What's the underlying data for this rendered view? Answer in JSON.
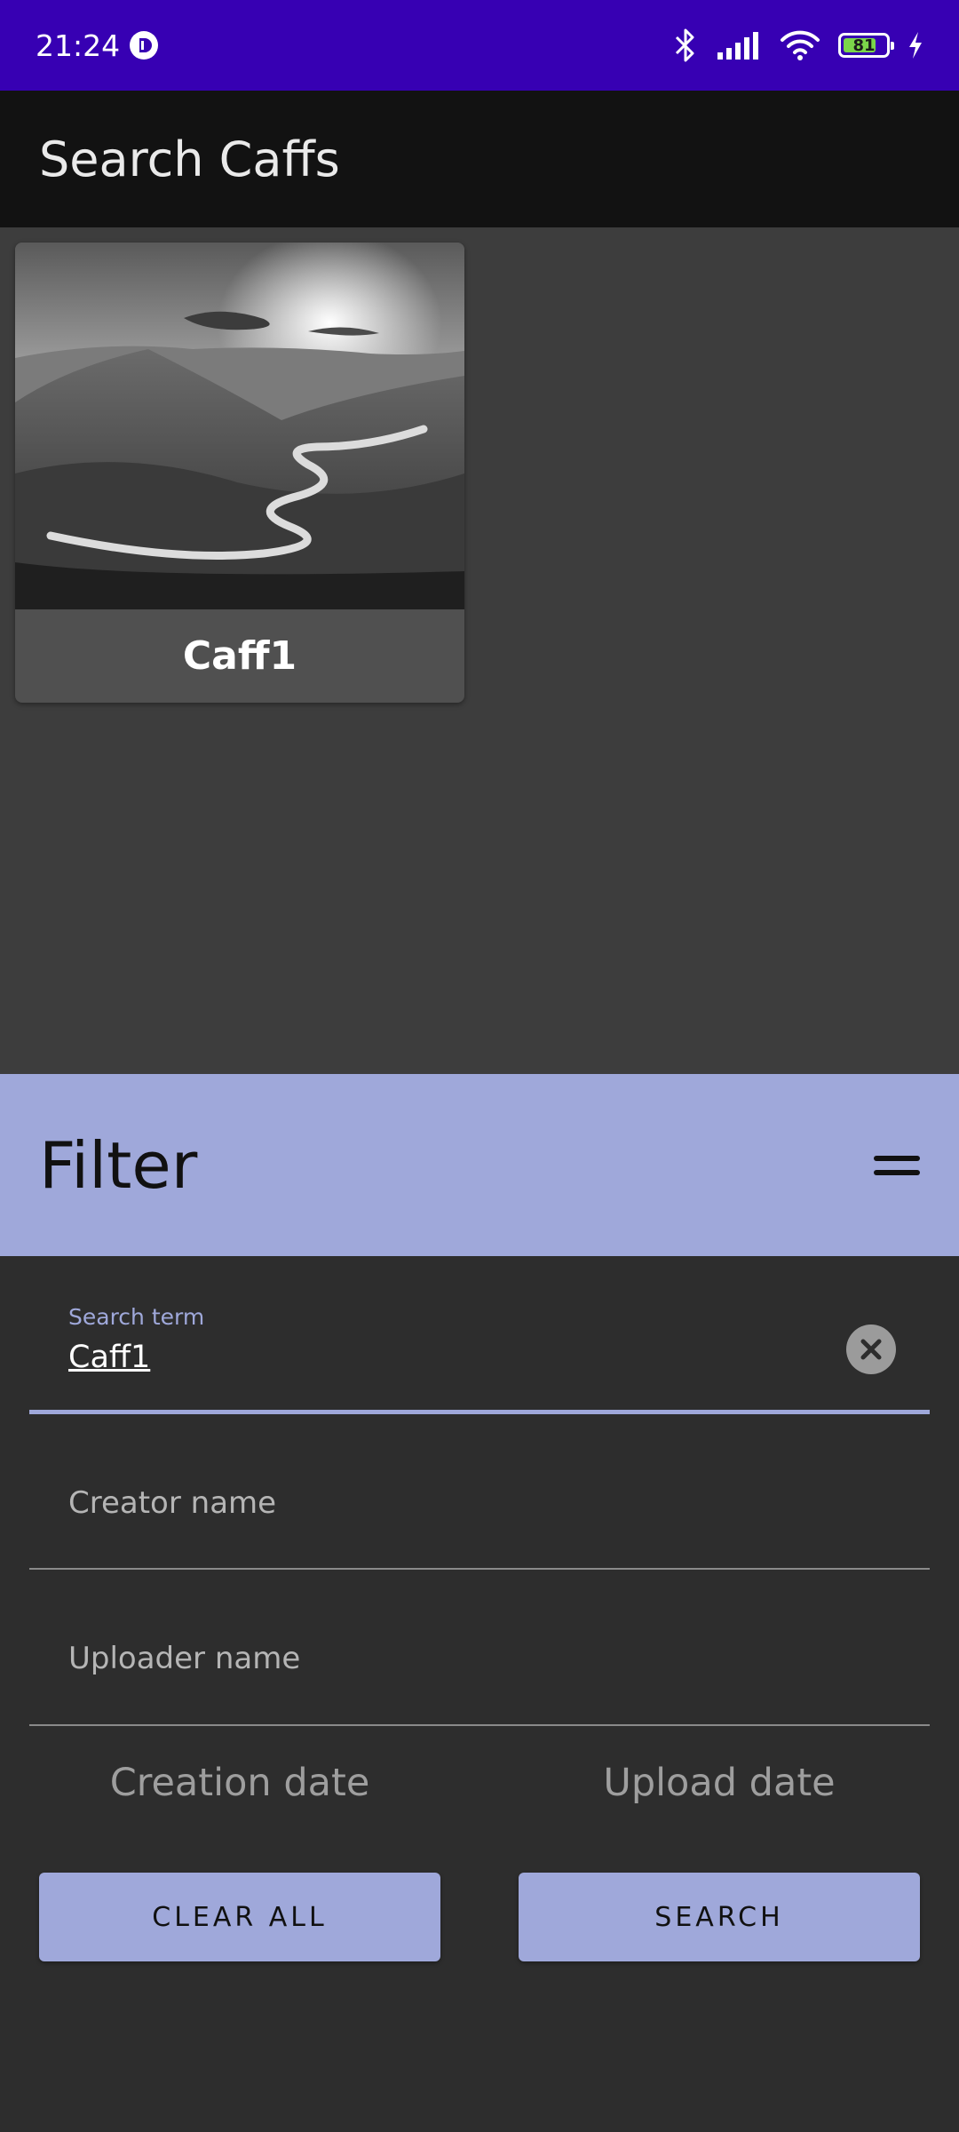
{
  "status": {
    "time": "21:24",
    "battery": "81",
    "battery_percent": 81
  },
  "app_bar": {
    "title": "Search Caffs"
  },
  "results": [
    {
      "title": "Caff1"
    }
  ],
  "filter": {
    "title": "Filter",
    "search_term": {
      "label": "Search term",
      "value": "Caff1"
    },
    "creator_name": {
      "placeholder": "Creator name"
    },
    "uploader_name": {
      "placeholder": "Uploader name"
    },
    "creation_date": "Creation date",
    "upload_date": "Upload date",
    "clear_all": "CLEAR ALL",
    "search": "SEARCH"
  },
  "colors": {
    "status_bar": "#3700b3",
    "accent": "#9fa8da",
    "app_bar": "#121212",
    "sheet": "#2d2d2d"
  }
}
